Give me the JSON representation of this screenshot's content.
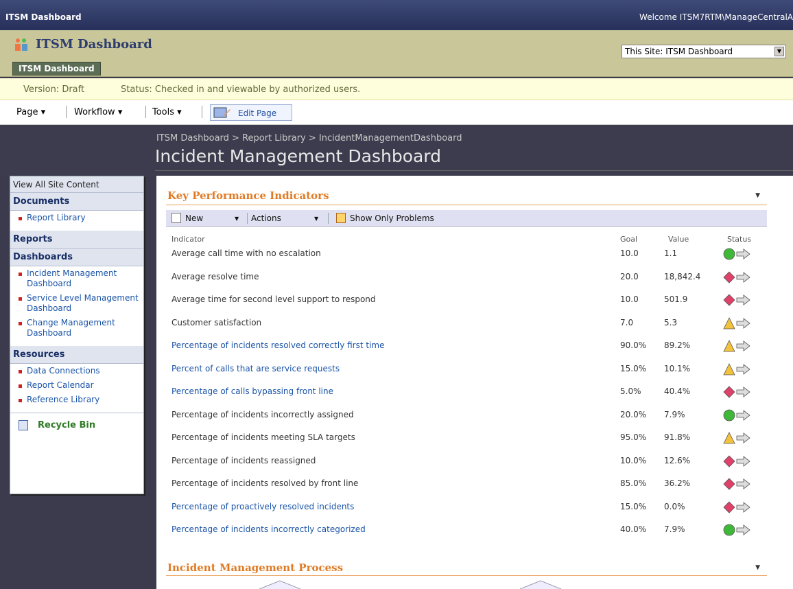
{
  "topbar": {
    "site_link": "ITSM Dashboard",
    "welcome": "Welcome ITSM7RTM\\ManageCentralA"
  },
  "header": {
    "site_title": "ITSM Dashboard",
    "tab": "ITSM Dashboard",
    "search_scope": "This Site: ITSM Dashboard"
  },
  "version_bar": {
    "version": "Version: Draft",
    "status": "Status: Checked in and viewable by authorized users."
  },
  "edit_toolbar": {
    "page_menu": "Page ▾",
    "workflow_menu": "Workflow ▾",
    "tools_menu": "Tools ▾",
    "edit_page": "Edit Page"
  },
  "title_area": {
    "breadcrumb": "ITSM Dashboard > Report Library > IncidentManagementDashboard",
    "page_title": "Incident Management Dashboard"
  },
  "leftnav": {
    "view_all": "View All Site Content",
    "documents_heading": "Documents",
    "documents": [
      "Report Library"
    ],
    "reports_heading": "Reports",
    "dashboards_heading": "Dashboards",
    "dashboards": [
      "Incident Management Dashboard",
      "Service Level Management Dashboard",
      "Change Management Dashboard"
    ],
    "resources_heading": "Resources",
    "resources": [
      "Data Connections",
      "Report Calendar",
      "Reference Library"
    ],
    "recycle_bin": "Recycle Bin"
  },
  "kpi": {
    "title": "Key Performance Indicators",
    "toolbar": {
      "new": "New",
      "actions": "Actions",
      "show_only_problems": "Show Only Problems"
    },
    "columns": {
      "indicator": "Indicator",
      "goal": "Goal",
      "value": "Value",
      "status": "Status"
    },
    "rows": [
      {
        "indicator": "Average call time with no escalation",
        "goal": "10.0",
        "value": "1.1",
        "status": "green",
        "link": false
      },
      {
        "indicator": "Average resolve time",
        "goal": "20.0",
        "value": "18,842.4",
        "status": "red",
        "link": false
      },
      {
        "indicator": "Average time for second level support to respond",
        "goal": "10.0",
        "value": "501.9",
        "status": "red",
        "link": false
      },
      {
        "indicator": "Customer satisfaction",
        "goal": "7.0",
        "value": "5.3",
        "status": "yellow",
        "link": false
      },
      {
        "indicator": "Percentage of incidents resolved correctly first time",
        "goal": "90.0%",
        "value": "89.2%",
        "status": "yellow",
        "link": true
      },
      {
        "indicator": "Percent of calls that are service requests",
        "goal": "15.0%",
        "value": "10.1%",
        "status": "yellow",
        "link": true
      },
      {
        "indicator": "Percentage of calls bypassing front line",
        "goal": "5.0%",
        "value": "40.4%",
        "status": "red",
        "link": true
      },
      {
        "indicator": "Percentage of incidents incorrectly assigned",
        "goal": "20.0%",
        "value": "7.9%",
        "status": "green",
        "link": false
      },
      {
        "indicator": "Percentage of incidents meeting SLA targets",
        "goal": "95.0%",
        "value": "91.8%",
        "status": "yellow",
        "link": false
      },
      {
        "indicator": "Percentage of incidents reassigned",
        "goal": "10.0%",
        "value": "12.6%",
        "status": "red",
        "link": false
      },
      {
        "indicator": "Percentage of incidents resolved by front line",
        "goal": "85.0%",
        "value": "36.2%",
        "status": "red",
        "link": false
      },
      {
        "indicator": "Percentage of proactively resolved incidents",
        "goal": "15.0%",
        "value": "0.0%",
        "status": "red",
        "link": true
      },
      {
        "indicator": "Percentage of incidents incorrectly categorized",
        "goal": "40.0%",
        "value": "7.9%",
        "status": "green",
        "link": true
      }
    ]
  },
  "process": {
    "title": "Incident Management Process"
  },
  "colors": {
    "green": "#3fb83a",
    "red": "#e0406a",
    "yellow": "#f3c23c",
    "accent": "#e07b25"
  }
}
